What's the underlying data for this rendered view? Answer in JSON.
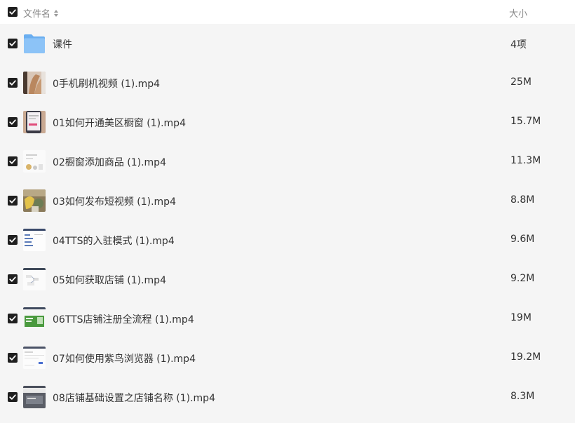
{
  "header": {
    "name_label": "文件名",
    "size_label": "大小"
  },
  "rows": [
    {
      "name": "课件",
      "size": "4项",
      "icon": "folder-icon"
    },
    {
      "name": "0手机刷机视频 (1).mp4",
      "size": "25M",
      "icon": "video-thumbnail"
    },
    {
      "name": "01如何开通美区橱窗 (1).mp4",
      "size": "15.7M",
      "icon": "video-thumbnail"
    },
    {
      "name": "02橱窗添加商品 (1).mp4",
      "size": "11.3M",
      "icon": "video-thumbnail"
    },
    {
      "name": "03如何发布短视频 (1).mp4",
      "size": "8.8M",
      "icon": "video-thumbnail"
    },
    {
      "name": "04TTS的入驻模式 (1).mp4",
      "size": "9.6M",
      "icon": "video-thumbnail"
    },
    {
      "name": "05如何获取店铺 (1).mp4",
      "size": "9.2M",
      "icon": "video-thumbnail"
    },
    {
      "name": "06TTS店铺注册全流程 (1).mp4",
      "size": "19M",
      "icon": "video-thumbnail"
    },
    {
      "name": "07如何使用紫鸟浏览器 (1).mp4",
      "size": "19.2M",
      "icon": "video-thumbnail"
    },
    {
      "name": "08店铺基础设置之店铺名称 (1).mp4",
      "size": "8.3M",
      "icon": "video-thumbnail"
    }
  ],
  "colors": {
    "list_background": "#f5f5f5",
    "checkbox_fill": "#1f1f1f",
    "folder_blue": "#7ab8f5",
    "header_text": "#888888",
    "row_text": "#333333"
  }
}
